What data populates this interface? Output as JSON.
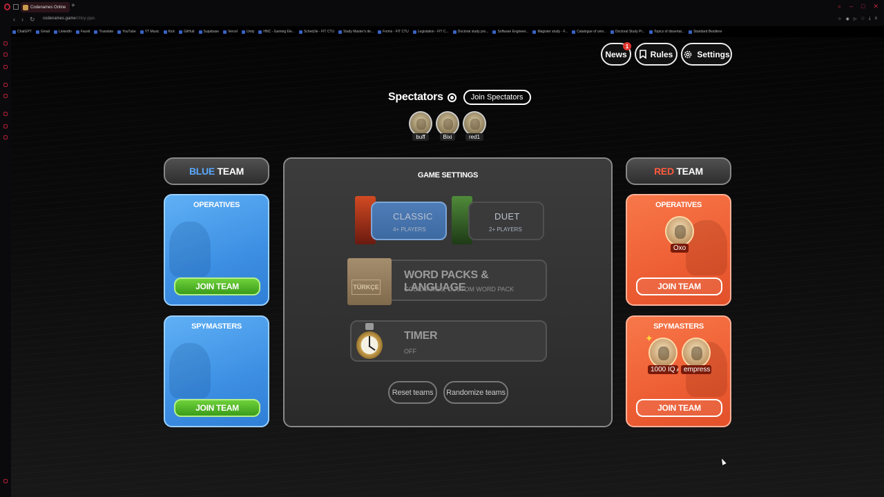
{
  "browser": {
    "tab_title": "Codenames Online",
    "new_tab": "+",
    "url_host": "codenames.game",
    "url_path": "/r/itoy-pjas",
    "bookmarks": [
      "ChatGPT",
      "Gmail",
      "LinkedIn",
      "Faceit",
      "Translate",
      "YouTube",
      "YT Music",
      "Kick",
      "GitHub",
      "Supabase",
      "Vercel",
      "Unity",
      "HNC - Gaming Ele...",
      "SchedJie - FIT CTU",
      "Study Master's de...",
      "Forms - FIT CTU",
      "Legislation - FIT C...",
      "Doctoral study pro...",
      "Software Engineer...",
      "Magister study - F...",
      "Catalogue of univ...",
      "Doctoral Study Pr...",
      "Topics of dissertat...",
      "Standard Bestitere"
    ]
  },
  "header": {
    "news_label": "News",
    "news_badge": "1",
    "rules_label": "Rules",
    "settings_label": "Settings"
  },
  "spectators": {
    "title": "Spectators",
    "join_label": "Join Spectators",
    "players": [
      "buff",
      "Bixi",
      "red1"
    ]
  },
  "blue_team": {
    "header_color_word": "BLUE",
    "header_word": "TEAM",
    "operatives_title": "OPERATIVES",
    "operatives_join": "JOIN TEAM",
    "spymasters_title": "SPYMASTERS",
    "spymasters_join": "JOIN TEAM"
  },
  "red_team": {
    "header_color_word": "RED",
    "header_word": "TEAM",
    "operatives_title": "OPERATIVES",
    "operatives_players": [
      "Oxo"
    ],
    "operatives_join": "JOIN TEAM",
    "spymasters_title": "SPYMASTERS",
    "spymasters_players": [
      "1000 IQ A",
      "empress"
    ],
    "spymasters_join": "JOIN TEAM"
  },
  "game_settings": {
    "title": "GAME SETTINGS",
    "modes": [
      {
        "label": "CLASSIC",
        "sub": "4+ PLAYERS",
        "active": true
      },
      {
        "label": "DUET",
        "sub": "2+ PLAYERS",
        "active": false
      }
    ],
    "word_packs": {
      "title": "WORD PACKS & LANGUAGE",
      "sub": "CODENAMES, CUSTOM WORD PACK",
      "box_label": "TÜRKÇE"
    },
    "timer": {
      "title": "TIMER",
      "sub": "OFF"
    },
    "reset_label": "Reset teams",
    "randomize_label": "Randomize teams"
  },
  "colors": {
    "blue_accent": "#5aa9ff",
    "red_accent": "#ff5a3c",
    "join_green": "#4cb828",
    "opera_red": "#c0243a"
  }
}
